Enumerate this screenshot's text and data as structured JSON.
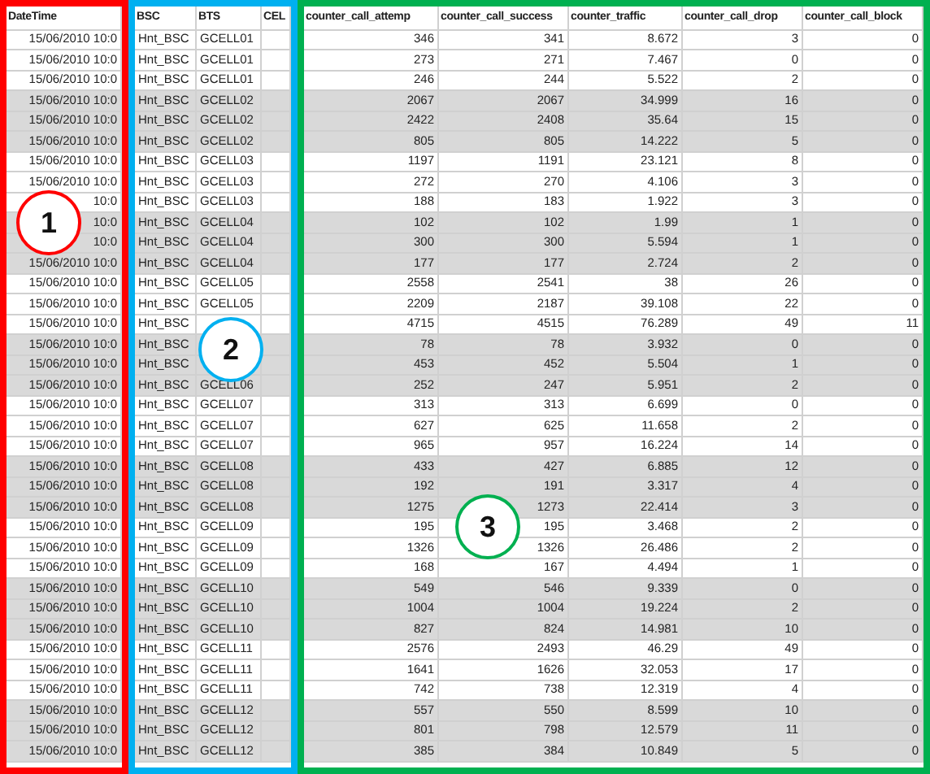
{
  "columns": [
    "DateTime",
    "BSC",
    "BTS",
    "CEL",
    "counter_call_attemp",
    "counter_call_success",
    "counter_traffic",
    "counter_call_drop",
    "counter_call_block"
  ],
  "rows": [
    {
      "datetime": "15/06/2010 10:0",
      "bsc": "Hnt_BSC",
      "bts": "GCELL01",
      "values": [
        "346",
        "341",
        "8.672",
        "3",
        "0"
      ],
      "shaded": false
    },
    {
      "datetime": "15/06/2010 10:0",
      "bsc": "Hnt_BSC",
      "bts": "GCELL01",
      "values": [
        "273",
        "271",
        "7.467",
        "0",
        "0"
      ],
      "shaded": false
    },
    {
      "datetime": "15/06/2010 10:0",
      "bsc": "Hnt_BSC",
      "bts": "GCELL01",
      "values": [
        "246",
        "244",
        "5.522",
        "2",
        "0"
      ],
      "shaded": false
    },
    {
      "datetime": "15/06/2010 10:0",
      "bsc": "Hnt_BSC",
      "bts": "GCELL02",
      "values": [
        "2067",
        "2067",
        "34.999",
        "16",
        "0"
      ],
      "shaded": true
    },
    {
      "datetime": "15/06/2010 10:0",
      "bsc": "Hnt_BSC",
      "bts": "GCELL02",
      "values": [
        "2422",
        "2408",
        "35.64",
        "15",
        "0"
      ],
      "shaded": true
    },
    {
      "datetime": "15/06/2010 10:0",
      "bsc": "Hnt_BSC",
      "bts": "GCELL02",
      "values": [
        "805",
        "805",
        "14.222",
        "5",
        "0"
      ],
      "shaded": true
    },
    {
      "datetime": "15/06/2010 10:0",
      "bsc": "Hnt_BSC",
      "bts": "GCELL03",
      "values": [
        "1197",
        "1191",
        "23.121",
        "8",
        "0"
      ],
      "shaded": false
    },
    {
      "datetime": "15/06/2010 10:0",
      "bsc": "Hnt_BSC",
      "bts": "GCELL03",
      "values": [
        "272",
        "270",
        "4.106",
        "3",
        "0"
      ],
      "shaded": false
    },
    {
      "datetime": "10:0",
      "bsc": "Hnt_BSC",
      "bts": "GCELL03",
      "values": [
        "188",
        "183",
        "1.922",
        "3",
        "0"
      ],
      "shaded": false
    },
    {
      "datetime": "10:0",
      "bsc": "Hnt_BSC",
      "bts": "GCELL04",
      "values": [
        "102",
        "102",
        "1.99",
        "1",
        "0"
      ],
      "shaded": true
    },
    {
      "datetime": "10:0",
      "bsc": "Hnt_BSC",
      "bts": "GCELL04",
      "values": [
        "300",
        "300",
        "5.594",
        "1",
        "0"
      ],
      "shaded": true
    },
    {
      "datetime": "15/06/2010 10:0",
      "bsc": "Hnt_BSC",
      "bts": "GCELL04",
      "values": [
        "177",
        "177",
        "2.724",
        "2",
        "0"
      ],
      "shaded": true
    },
    {
      "datetime": "15/06/2010 10:0",
      "bsc": "Hnt_BSC",
      "bts": "GCELL05",
      "values": [
        "2558",
        "2541",
        "38",
        "26",
        "0"
      ],
      "shaded": false
    },
    {
      "datetime": "15/06/2010 10:0",
      "bsc": "Hnt_BSC",
      "bts": "GCELL05",
      "values": [
        "2209",
        "2187",
        "39.108",
        "22",
        "0"
      ],
      "shaded": false
    },
    {
      "datetime": "15/06/2010 10:0",
      "bsc": "Hnt_BSC",
      "values": [
        "4715",
        "4515",
        "76.289",
        "49",
        "11"
      ],
      "shaded": false
    },
    {
      "datetime": "15/06/2010 10:0",
      "bsc": "Hnt_BSC",
      "values": [
        "78",
        "78",
        "3.932",
        "0",
        "0"
      ],
      "shaded": true
    },
    {
      "datetime": "15/06/2010 10:0",
      "bsc": "Hnt_BSC",
      "values": [
        "453",
        "452",
        "5.504",
        "1",
        "0"
      ],
      "shaded": true
    },
    {
      "datetime": "15/06/2010 10:0",
      "bsc": "Hnt_BSC",
      "bts": "GCELL06",
      "values": [
        "252",
        "247",
        "5.951",
        "2",
        "0"
      ],
      "shaded": true
    },
    {
      "datetime": "15/06/2010 10:0",
      "bsc": "Hnt_BSC",
      "bts": "GCELL07",
      "values": [
        "313",
        "313",
        "6.699",
        "0",
        "0"
      ],
      "shaded": false
    },
    {
      "datetime": "15/06/2010 10:0",
      "bsc": "Hnt_BSC",
      "bts": "GCELL07",
      "values": [
        "627",
        "625",
        "11.658",
        "2",
        "0"
      ],
      "shaded": false
    },
    {
      "datetime": "15/06/2010 10:0",
      "bsc": "Hnt_BSC",
      "bts": "GCELL07",
      "values": [
        "965",
        "957",
        "16.224",
        "14",
        "0"
      ],
      "shaded": false
    },
    {
      "datetime": "15/06/2010 10:0",
      "bsc": "Hnt_BSC",
      "bts": "GCELL08",
      "values": [
        "433",
        "427",
        "6.885",
        "12",
        "0"
      ],
      "shaded": true
    },
    {
      "datetime": "15/06/2010 10:0",
      "bsc": "Hnt_BSC",
      "bts": "GCELL08",
      "values": [
        "192",
        "191",
        "3.317",
        "4",
        "0"
      ],
      "shaded": true
    },
    {
      "datetime": "15/06/2010 10:0",
      "bsc": "Hnt_BSC",
      "bts": "GCELL08",
      "values": [
        "1275",
        "1273",
        "22.414",
        "3",
        "0"
      ],
      "shaded": true
    },
    {
      "datetime": "15/06/2010 10:0",
      "bsc": "Hnt_BSC",
      "bts": "GCELL09",
      "values": [
        "195",
        "195",
        "3.468",
        "2",
        "0"
      ],
      "shaded": false
    },
    {
      "datetime": "15/06/2010 10:0",
      "bsc": "Hnt_BSC",
      "bts": "GCELL09",
      "values": [
        "1326",
        "1326",
        "26.486",
        "2",
        "0"
      ],
      "shaded": false
    },
    {
      "datetime": "15/06/2010 10:0",
      "bsc": "Hnt_BSC",
      "bts": "GCELL09",
      "values": [
        "168",
        "167",
        "4.494",
        "1",
        "0"
      ],
      "shaded": false
    },
    {
      "datetime": "15/06/2010 10:0",
      "bsc": "Hnt_BSC",
      "bts": "GCELL10",
      "values": [
        "549",
        "546",
        "9.339",
        "0",
        "0"
      ],
      "shaded": true
    },
    {
      "datetime": "15/06/2010 10:0",
      "bsc": "Hnt_BSC",
      "bts": "GCELL10",
      "values": [
        "1004",
        "1004",
        "19.224",
        "2",
        "0"
      ],
      "shaded": true
    },
    {
      "datetime": "15/06/2010 10:0",
      "bsc": "Hnt_BSC",
      "bts": "GCELL10",
      "values": [
        "827",
        "824",
        "14.981",
        "10",
        "0"
      ],
      "shaded": true
    },
    {
      "datetime": "15/06/2010 10:0",
      "bsc": "Hnt_BSC",
      "bts": "GCELL11",
      "values": [
        "2576",
        "2493",
        "46.29",
        "49",
        "0"
      ],
      "shaded": false
    },
    {
      "datetime": "15/06/2010 10:0",
      "bsc": "Hnt_BSC",
      "bts": "GCELL11",
      "values": [
        "1641",
        "1626",
        "32.053",
        "17",
        "0"
      ],
      "shaded": false
    },
    {
      "datetime": "15/06/2010 10:0",
      "bsc": "Hnt_BSC",
      "bts": "GCELL11",
      "values": [
        "742",
        "738",
        "12.319",
        "4",
        "0"
      ],
      "shaded": false
    },
    {
      "datetime": "15/06/2010 10:0",
      "bsc": "Hnt_BSC",
      "bts": "GCELL12",
      "values": [
        "557",
        "550",
        "8.599",
        "10",
        "0"
      ],
      "shaded": true
    },
    {
      "datetime": "15/06/2010 10:0",
      "bsc": "Hnt_BSC",
      "bts": "GCELL12",
      "values": [
        "801",
        "798",
        "12.579",
        "11",
        "0"
      ],
      "shaded": true
    },
    {
      "datetime": "15/06/2010 10:0",
      "bsc": "Hnt_BSC",
      "bts": "GCELL12",
      "values": [
        "385",
        "384",
        "10.849",
        "5",
        "0"
      ],
      "shaded": true
    }
  ],
  "annotations": [
    {
      "label": "1",
      "color": "#ff0000"
    },
    {
      "label": "2",
      "color": "#00b0f0"
    },
    {
      "label": "3",
      "color": "#00b050"
    }
  ]
}
